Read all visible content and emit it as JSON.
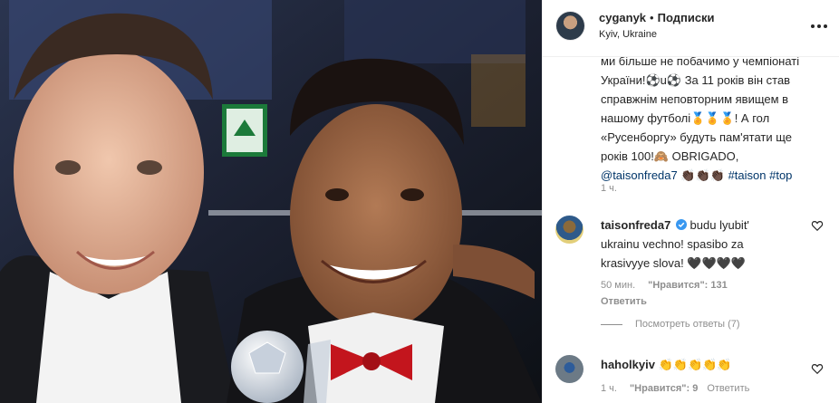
{
  "post": {
    "username": "cyganyk",
    "separator": "•",
    "follow_label": "Подписки",
    "location": "Kyiv, Ukraine",
    "more_icon": "more-horizontal-icon"
  },
  "caption": {
    "line1": "ми більше не побачимо у чемпіонаті",
    "line2": "України!⚽u⚽ За 11 років він став",
    "line3": "справжнім неповторним явищем в",
    "line4": "нашому футболі🏅🏅🏅! А гол",
    "line5": "«Русенборгу» будуть пам'ятати ще",
    "line6": "років 100!🙈 OBRIGADO,",
    "mention": "@taisonfreda7",
    "hands": "👏🏿👏🏿👏🏿",
    "tag1": "#taison",
    "tag2": "#top",
    "time": "1 ч."
  },
  "comments": [
    {
      "username": "taisonfreda7",
      "verified_icon": "verified-badge-icon",
      "line1": " budu lyubit'",
      "line2": "ukrainu vechno! spasibo za",
      "line3": "krasivyye slova! 🖤🖤🖤🖤",
      "time": "50 мин.",
      "likes": "\"Нравится\": 131",
      "reply": "Ответить",
      "like_icon": "heart-outline-icon"
    },
    {
      "username": "haholkyiv",
      "text": " 👏👏👏👏👏",
      "time": "1 ч.",
      "likes": "\"Нравится\": 9",
      "reply": "Ответить",
      "like_icon": "heart-outline-icon"
    }
  ],
  "view_replies": "Посмотреть ответы (7)",
  "colors": {
    "text": "#262626",
    "muted": "#8e8e8e",
    "link": "#003569",
    "verified": "#3897f0",
    "divider": "#efefef"
  }
}
